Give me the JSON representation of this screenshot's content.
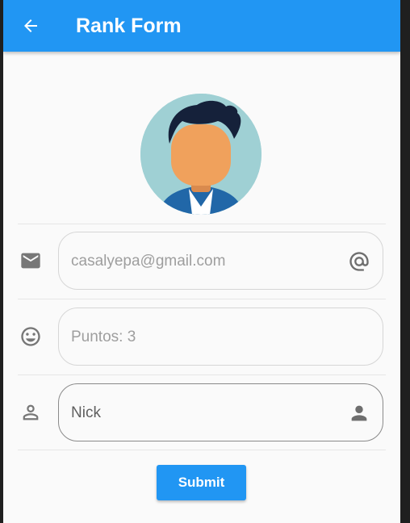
{
  "appbar": {
    "title": "Rank Form",
    "color": "#2196f3",
    "back_icon": "arrow-back-icon"
  },
  "avatar": {
    "description_icon": "avatar-icon"
  },
  "form": {
    "email": {
      "icon": "mail-icon",
      "placeholder": "casalyepa@gmail.com",
      "suffix_icon": "at-sign-icon"
    },
    "points": {
      "icon": "smiley-icon",
      "placeholder": "Puntos: 3"
    },
    "nick": {
      "icon": "person-outline-icon",
      "value": "Nick",
      "suffix_icon": "person-icon"
    },
    "submit_label": "Submit"
  }
}
